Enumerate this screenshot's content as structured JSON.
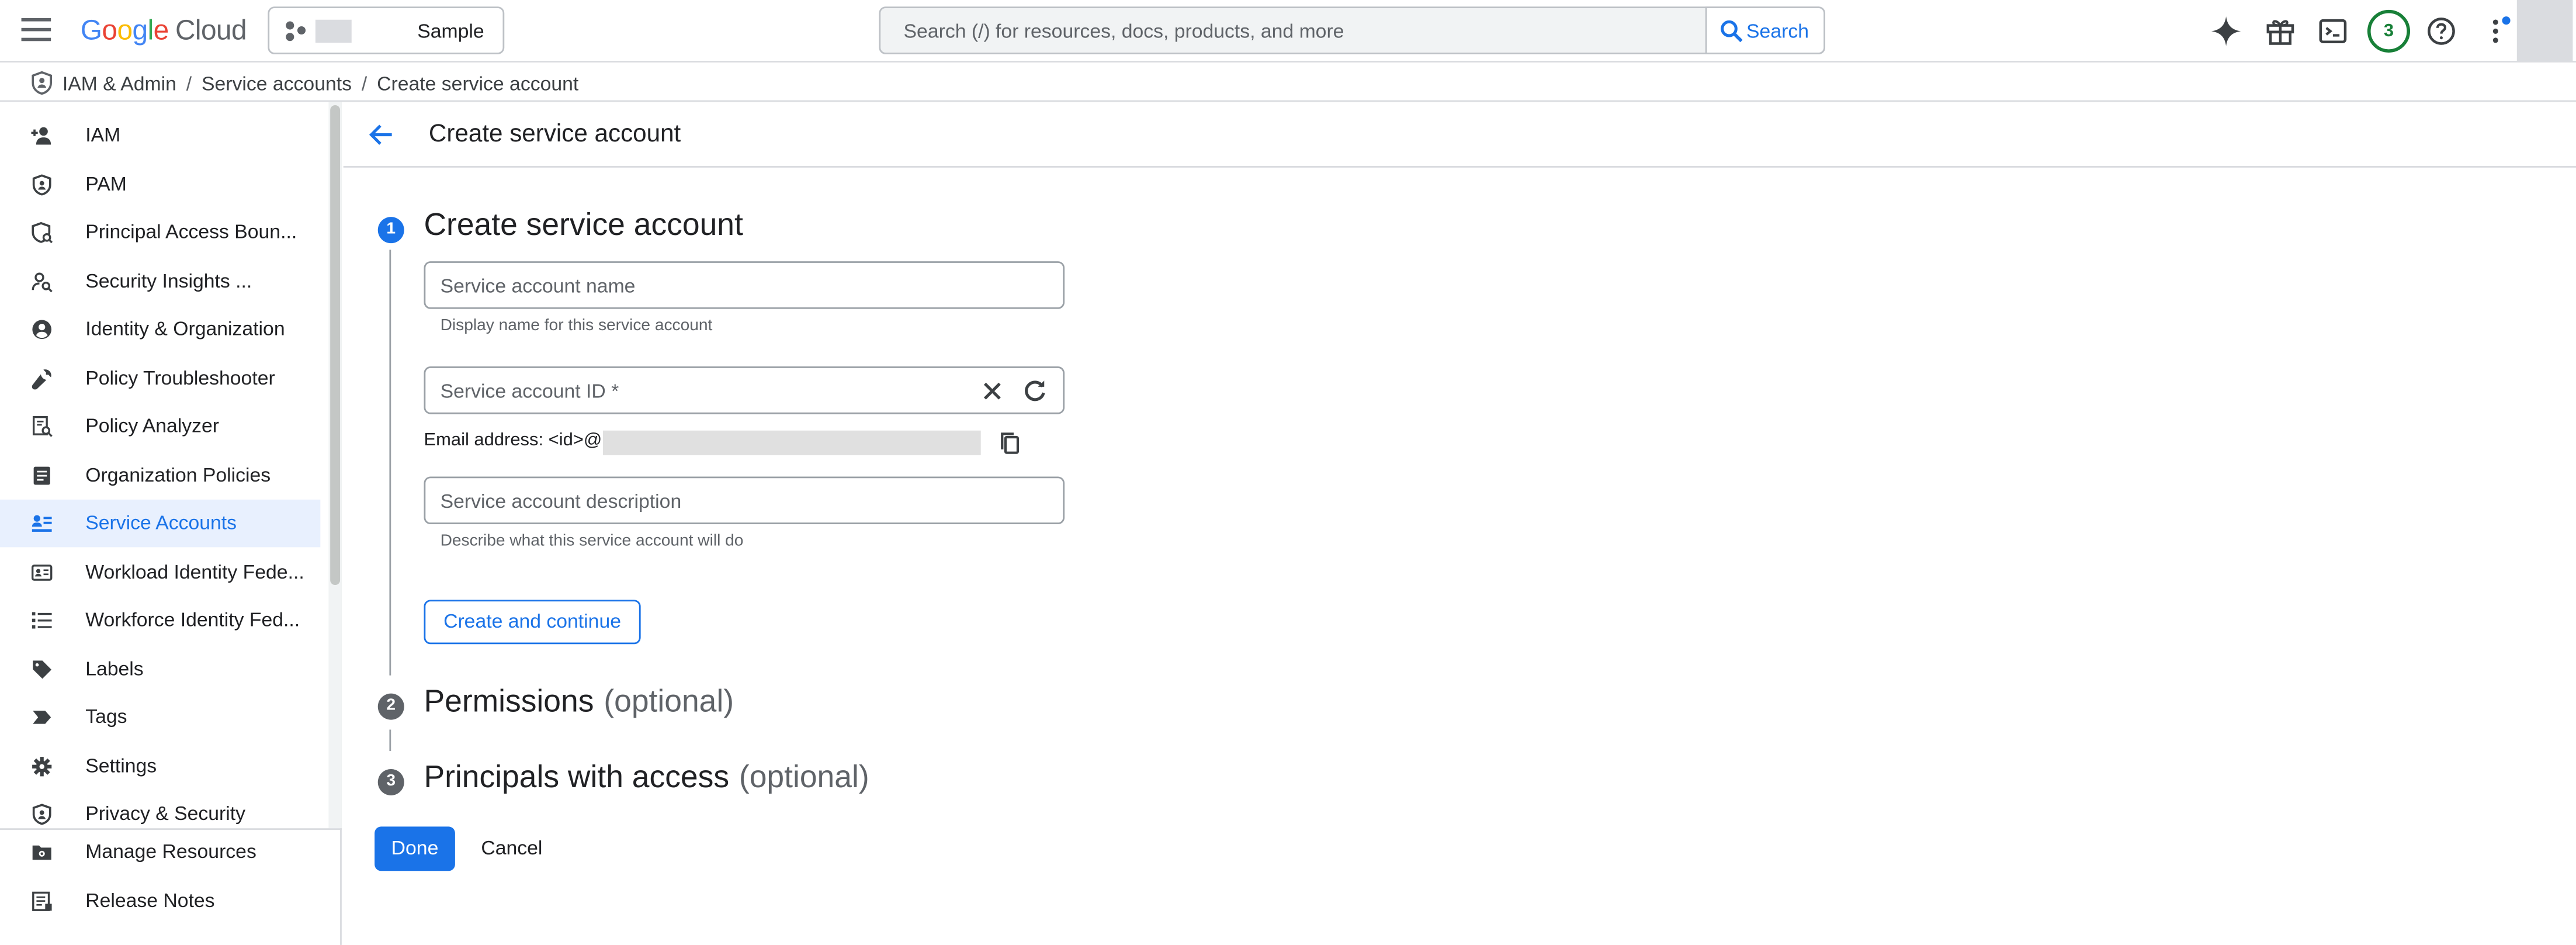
{
  "header": {
    "logo": {
      "g": "G",
      "o1": "o",
      "o2": "o",
      "g2": "g",
      "l": "l",
      "e": "e",
      "cloud": "Cloud"
    },
    "project_name": "Sample",
    "search_placeholder": "Search (/) for resources, docs, products, and more",
    "search_button": "Search",
    "notification_count": "3",
    "icons": [
      "menu-icon",
      "project-icon",
      "search-icon",
      "gemini-icon",
      "gift-icon",
      "cloud-shell-icon",
      "help-icon",
      "more-vert-icon"
    ]
  },
  "breadcrumb": {
    "items": [
      "IAM & Admin",
      "Service accounts",
      "Create service account"
    ],
    "separator": "/"
  },
  "sidebar": {
    "items": [
      {
        "label": "IAM",
        "icon": "person-add-icon"
      },
      {
        "label": "PAM",
        "icon": "shield-icon"
      },
      {
        "label": "Principal Access Boun...",
        "icon": "policy-shield-icon"
      },
      {
        "label": "Security Insights ...",
        "icon": "person-search-icon"
      },
      {
        "label": "Identity & Organization",
        "icon": "account-circle-icon"
      },
      {
        "label": "Policy Troubleshooter",
        "icon": "wrench-icon"
      },
      {
        "label": "Policy Analyzer",
        "icon": "document-search-icon"
      },
      {
        "label": "Organization Policies",
        "icon": "list-document-icon"
      },
      {
        "label": "Service Accounts",
        "icon": "service-account-icon",
        "active": true
      },
      {
        "label": "Workload Identity Fede...",
        "icon": "id-card-icon"
      },
      {
        "label": "Workforce Identity Fed...",
        "icon": "list-icon"
      },
      {
        "label": "Labels",
        "icon": "label-icon"
      },
      {
        "label": "Tags",
        "icon": "tag-arrow-icon"
      },
      {
        "label": "Settings",
        "icon": "gear-icon"
      },
      {
        "label": "Privacy & Security",
        "icon": "privacy-shield-icon"
      }
    ],
    "bottom_items": [
      {
        "label": "Manage Resources",
        "icon": "folder-gear-icon"
      },
      {
        "label": "Release Notes",
        "icon": "notes-icon"
      }
    ]
  },
  "page": {
    "title": "Create service account"
  },
  "steps": [
    {
      "number": "1",
      "title": "Create service account",
      "optional": ""
    },
    {
      "number": "2",
      "title": "Permissions",
      "optional": "(optional)"
    },
    {
      "number": "3",
      "title": "Principals with access",
      "optional": "(optional)"
    }
  ],
  "form": {
    "name": {
      "placeholder": "Service account name",
      "value": "",
      "helper": "Display name for this service account"
    },
    "id": {
      "placeholder": "Service account ID *",
      "value": ""
    },
    "email_label": "Email address: <id>@",
    "description": {
      "placeholder": "Service account description",
      "value": "",
      "helper": "Describe what this service account will do"
    },
    "create_button": "Create and continue"
  },
  "actions": {
    "done": "Done",
    "cancel": "Cancel"
  },
  "colors": {
    "accent": "#1a73e8",
    "active_bg": "#e8f0fe",
    "border": "#dadce0",
    "badge": "#188038"
  }
}
